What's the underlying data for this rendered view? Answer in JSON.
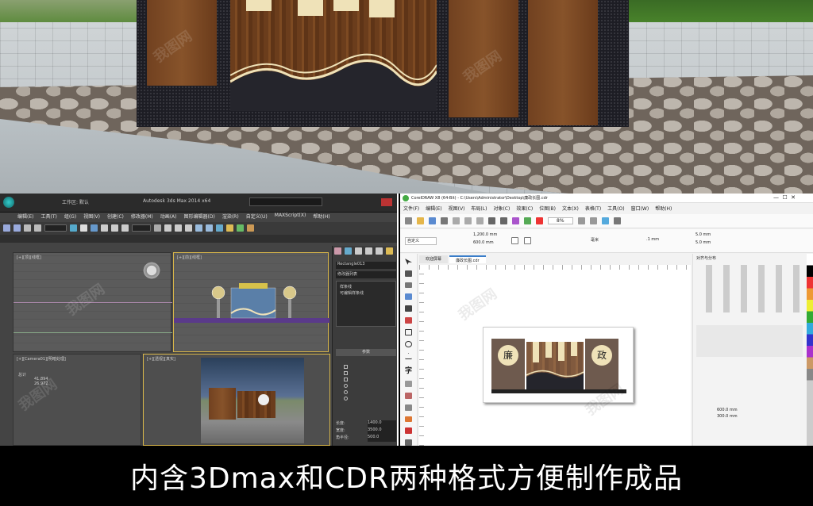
{
  "caption": "内含3Dmax和CDR两种格式方便制作成品",
  "watermark": "我图网",
  "max": {
    "title": "Autodesk 3ds Max 2014 x64",
    "file": "工作区: 默认",
    "menus": [
      "编辑(E)",
      "工具(T)",
      "组(G)",
      "视图(V)",
      "创建(C)",
      "修改器(M)",
      "动画(A)",
      "图形编辑器(D)",
      "渲染(R)",
      "自定义(U)",
      "MAXScript(X)",
      "帮助(H)"
    ],
    "viewports": {
      "top": "[+][顶][线框]",
      "front": "[+][前][线框]",
      "left": "[+][Camera01][明暗处理]",
      "persp": "[+][透视][真实]"
    },
    "stats": {
      "label1": "总计",
      "v1": "41,894",
      "v2": "26,972"
    },
    "panel": {
      "object": "Rectangle013",
      "modifier_list": "修改器列表",
      "items": [
        "样条线",
        "可编辑样条线"
      ],
      "rollout": "参数",
      "fields": [
        {
          "label": "长度:",
          "value": "1400.0"
        },
        {
          "label": "宽度:",
          "value": "3500.0"
        },
        {
          "label": "角半径:",
          "value": "500.0"
        }
      ]
    }
  },
  "cdr": {
    "title": "CorelDRAW X8 (64-Bit) - C:\\Users\\Administrator\\Desktop\\廉政长图.cdr",
    "menus": [
      "文件(F)",
      "编辑(E)",
      "视图(V)",
      "布局(L)",
      "对象(C)",
      "效果(C)",
      "位图(B)",
      "文本(X)",
      "表格(T)",
      "工具(O)",
      "窗口(W)",
      "帮助(H)"
    ],
    "zoom": "8%",
    "tabs": [
      "欢迎屏幕",
      "廉政长图.cdr"
    ],
    "size_w": "1,200.0 mm",
    "size_h": "600.0 mm",
    "unit": "毫米",
    "nudge": ".1 mm",
    "dup1": "5.0 mm",
    "dup2": "5.0 mm",
    "preset": "自定义",
    "docker_title": "对齐与分布",
    "docker_w": "600.0 mm",
    "docker_h": "300.0 mm",
    "sign_left": "廉",
    "sign_right": "政"
  },
  "colors": {
    "max_bg": "#444444",
    "cdr_bg": "#f2f2f2",
    "wood": "#7d4a22",
    "cream": "#efe2b8"
  }
}
